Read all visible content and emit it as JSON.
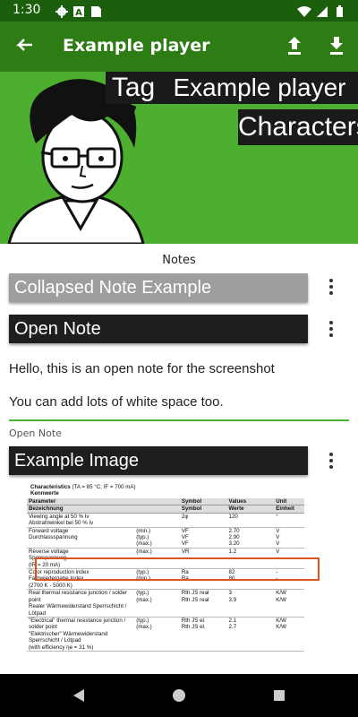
{
  "status_bar": {
    "time": "1:30",
    "icons": [
      "settings-icon",
      "a-notification-icon",
      "sd-card-icon"
    ],
    "right_icons": [
      "wifi-icon",
      "signal-icon",
      "battery-icon"
    ]
  },
  "app_bar": {
    "title": "Example player",
    "icons": [
      "back-arrow-icon",
      "upload-icon",
      "download-icon"
    ]
  },
  "banner": {
    "tag_label": "Tag",
    "player_name": "Example player",
    "category_label": "Characters"
  },
  "notes": {
    "section_title": "Notes",
    "items": [
      {
        "title": "Collapsed Note Example"
      },
      {
        "title": "Open Note"
      }
    ],
    "open_note_lines": [
      "Hello, this is an open note for the screenshot",
      "You can add lots of white space too."
    ],
    "open_note_label": "Open Note",
    "image_note_title": "Example Image"
  },
  "datasheet": {
    "title": "Characteristics",
    "title_conditions": "(TA = 85 °C; IF = 700 mA)",
    "subtitle": "Kennwerte",
    "headers": [
      [
        "Parameter",
        "",
        "Symbol",
        "Values",
        "Unit"
      ],
      [
        "Bezeichnung",
        "",
        "Symbol",
        "Werte",
        "Einheit"
      ]
    ],
    "rows": [
      {
        "param": [
          "Viewing angle at 50 % Iv",
          "Abstrahlwinkel bei 50 % Iv"
        ],
        "cond": [
          ""
        ],
        "sym": [
          "2φ"
        ],
        "val": [
          "120"
        ],
        "unit": [
          "°"
        ]
      },
      {
        "param": [
          "Forward voltage",
          "Durchlassspannung"
        ],
        "cond": [
          "(min.)",
          "(typ.)",
          "(max.)"
        ],
        "sym": [
          "VF",
          "VF",
          "VF"
        ],
        "val": [
          "2.70",
          "2.90",
          "3.20"
        ],
        "unit": [
          "V",
          "V",
          "V"
        ]
      },
      {
        "param": [
          "Reverse voltage",
          "Sperrspannung",
          "(IR = 20 mA)"
        ],
        "cond": [
          "(max.)"
        ],
        "sym": [
          "VR"
        ],
        "val": [
          "1.2"
        ],
        "unit": [
          "V"
        ]
      },
      {
        "param": [
          "Color reproduction index",
          "Farbwiedergabe Index",
          "(2700 K - 5000 K)"
        ],
        "cond": [
          "(typ.)",
          "(min.)"
        ],
        "sym": [
          "Ra",
          "Ra"
        ],
        "val": [
          "82",
          "80"
        ],
        "unit": [
          "-",
          "-"
        ]
      },
      {
        "param": [
          "Real thermal resistance junction / solder point",
          "Realer Wärmewiderstand Sperrschicht / Lötpad"
        ],
        "cond": [
          "(typ.)",
          "(max.)"
        ],
        "sym": [
          "Rth JS real",
          "Rth JS real"
        ],
        "val": [
          "3",
          "3.9"
        ],
        "unit": [
          "K/W",
          "K/W"
        ]
      },
      {
        "param": [
          "\"Electrical\" thermal resistance junction / solder point",
          "\"Elektrischer\" Wärmewiderstand Sperrschicht / Lötpad",
          "(with efficiency ηe = 31 %)"
        ],
        "cond": [
          "(typ.)",
          "(max.)"
        ],
        "sym": [
          "Rth JS el.",
          "Rth JS el."
        ],
        "val": [
          "2.1",
          "2.7"
        ],
        "unit": [
          "K/W",
          "K/W"
        ]
      }
    ]
  },
  "nav_bar": {
    "icons": [
      "back-triangle-icon",
      "home-circle-icon",
      "recents-square-icon"
    ]
  },
  "colors": {
    "status_bar": "#1b5e0c",
    "app_bar": "#2e7d14",
    "accent_green": "#4caf2f",
    "collapsed_note": "#9e9e9e",
    "open_note": "#1e1e1e",
    "highlight_box": "#d9541e"
  }
}
